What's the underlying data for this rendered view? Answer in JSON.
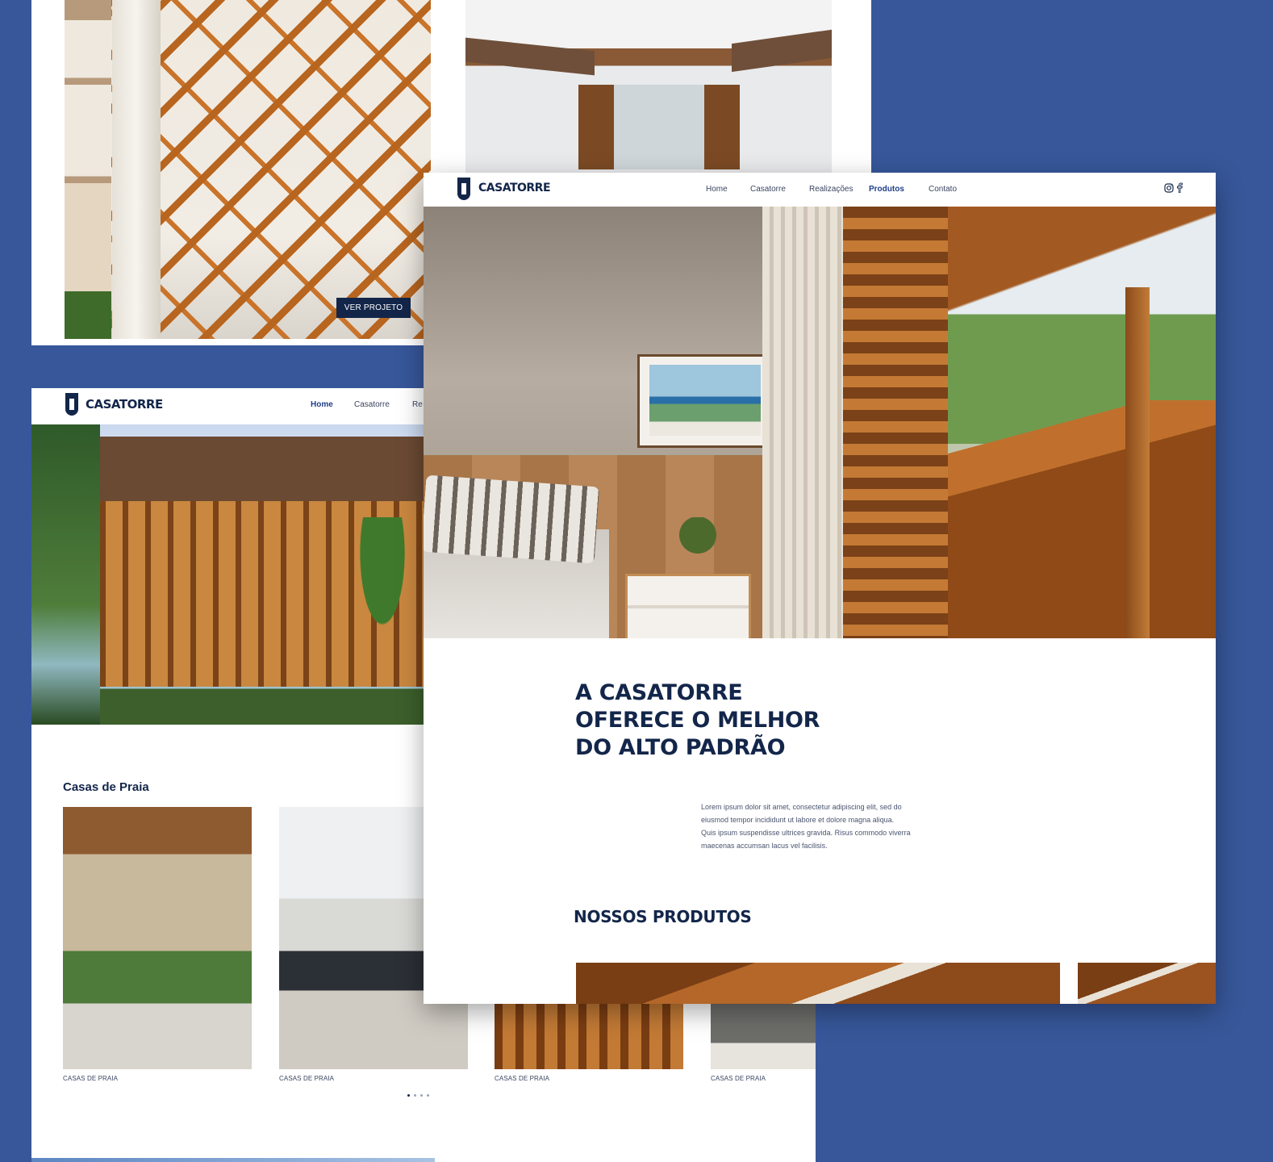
{
  "colors": {
    "background": "#37579a",
    "navy": "#13264a",
    "nav_active": "#1f3f8a",
    "text": "#3a4560"
  },
  "panel_stairs": {
    "button_label": "VER PROJETO"
  },
  "left_page": {
    "logo": "CASATORRE",
    "nav": [
      "Home",
      "Casatorre",
      "Re"
    ],
    "section_title": "Casas de Praia",
    "cards": [
      {
        "caption": "CASAS DE PRAIA"
      },
      {
        "caption": "CASAS DE PRAIA"
      },
      {
        "caption": "CASAS DE PRAIA"
      },
      {
        "caption": "CASAS DE PRAIA"
      }
    ],
    "pagination": {
      "total": 4,
      "active": 1
    }
  },
  "main_page": {
    "logo": "CASATORRE",
    "nav": [
      {
        "label": "Home",
        "active": false
      },
      {
        "label": "Casatorre",
        "active": false
      },
      {
        "label": "Realizações",
        "active": false
      },
      {
        "label": "Produtos",
        "active": true
      },
      {
        "label": "Contato",
        "active": false
      }
    ],
    "social_icons": [
      "instagram-icon",
      "facebook-icon"
    ],
    "headline": [
      "A CASATORRE",
      "OFERECE O MELHOR",
      "DO ALTO PADRÃO"
    ],
    "body": [
      "Lorem ipsum dolor sit amet, consectetur adipiscing elit, sed do",
      "eiusmod tempor incididunt ut labore et dolore magna aliqua.",
      "Quis ipsum suspendisse ultrices gravida. Risus commodo viverra",
      "maecenas accumsan lacus vel facilisis."
    ],
    "products_title": "NOSSOS PRODUTOS"
  }
}
